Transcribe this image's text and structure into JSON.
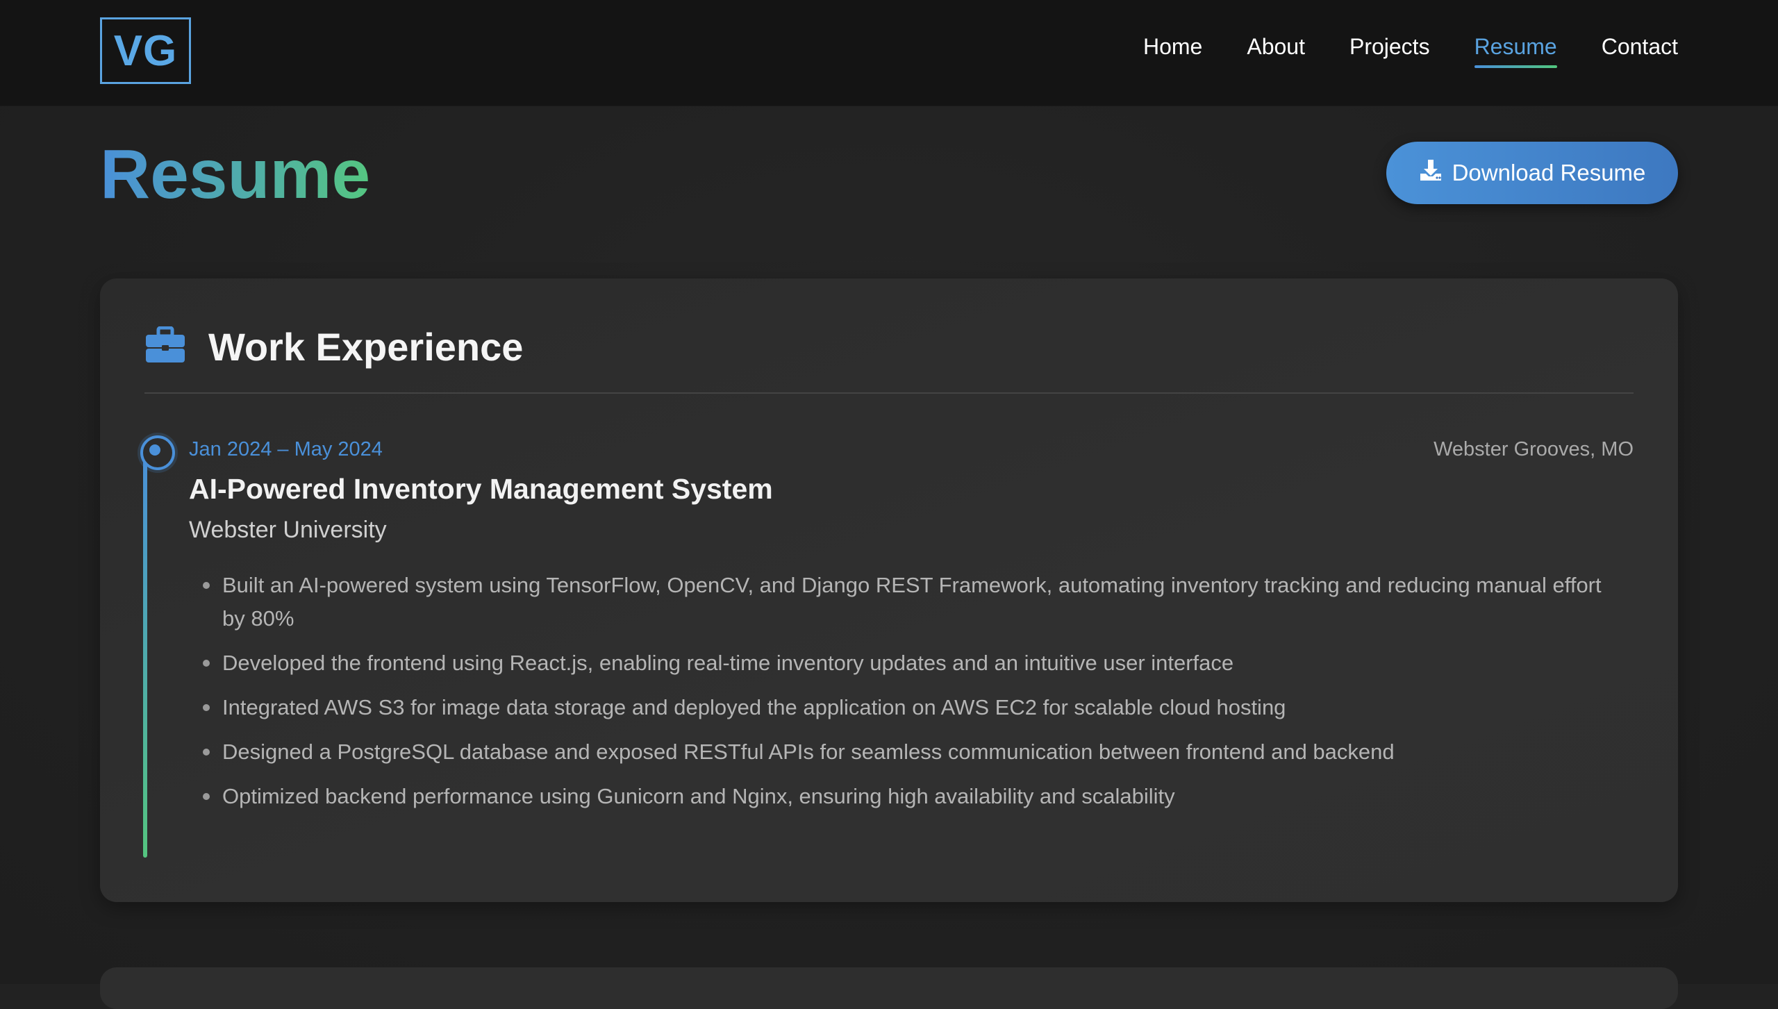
{
  "logo": "VG",
  "nav": {
    "items": [
      "Home",
      "About",
      "Projects",
      "Resume",
      "Contact"
    ],
    "active": "Resume"
  },
  "page": {
    "title": "Resume",
    "download_label": "Download Resume"
  },
  "work": {
    "title": "Work Experience",
    "entry": {
      "date": "Jan 2024 – May 2024",
      "location": "Webster Grooves, MO",
      "title": "AI-Powered Inventory Management System",
      "org": "Webster University",
      "bullets": [
        "Built an AI-powered system using TensorFlow, OpenCV, and Django REST Framework, automating inventory tracking and reducing manual effort by 80%",
        "Developed the frontend using React.js, enabling real-time inventory updates and an intuitive user interface",
        "Integrated AWS S3 for image data storage and deployed the application on AWS EC2 for scalable cloud hosting",
        "Designed a PostgreSQL database and exposed RESTful APIs for seamless communication between frontend and backend",
        "Optimized backend performance using Gunicorn and Nginx, ensuring high availability and scalability"
      ]
    }
  },
  "colors": {
    "accent_blue": "#4a90d9",
    "accent_green": "#55c681",
    "background": "#222222",
    "card": "#2e2e2e"
  },
  "icons": {
    "download": "download-icon",
    "work": "briefcase-icon",
    "timeline": "timeline-dot-icon"
  }
}
